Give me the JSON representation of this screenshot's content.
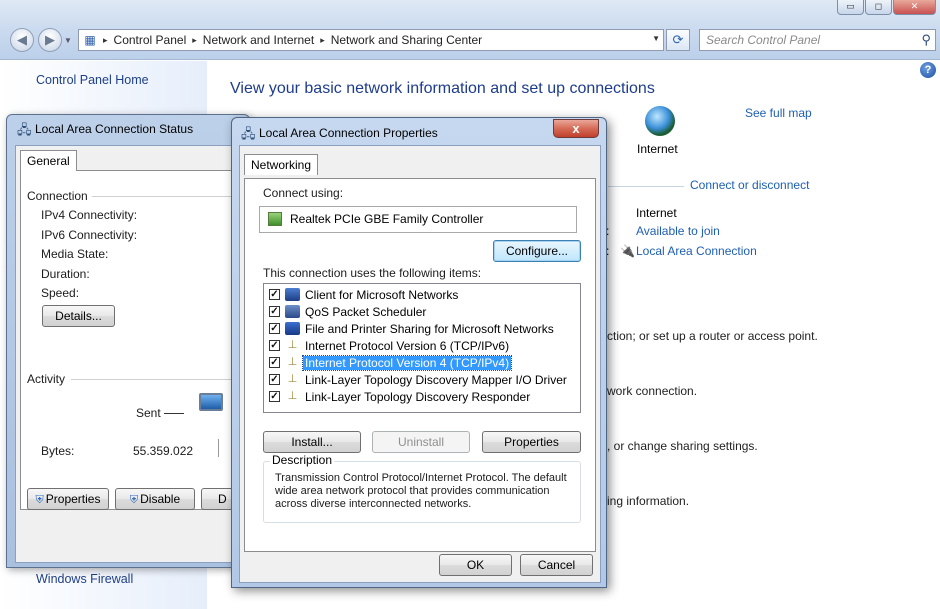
{
  "explorer": {
    "breadcrumb": [
      "Control Panel",
      "Network and Internet",
      "Network and Sharing Center"
    ],
    "search_placeholder": "Search Control Panel",
    "left_nav": {
      "home": "Control Panel Home",
      "firewall": "Windows Firewall"
    },
    "heading": "View your basic network information and set up connections",
    "see_full_map": "See full map",
    "internet_label": "Internet",
    "connect_or_disconnect": "Connect or disconnect",
    "access_type_value": "Internet",
    "homegroup_value": "Available to join",
    "connections_value": "Local Area Connection",
    "partial_lines": [
      "ction; or set up a router or access point.",
      "work connection.",
      ", or change sharing settings.",
      "ing information."
    ],
    "window_buttons": {
      "minimize": "▭",
      "maximize": "◻",
      "close": "✕"
    }
  },
  "status_dialog": {
    "title": "Local Area Connection Status",
    "tab": "General",
    "connection_group": "Connection",
    "fields": [
      "IPv4 Connectivity:",
      "IPv6 Connectivity:",
      "Media State:",
      "Duration:",
      "Speed:"
    ],
    "details_button": "Details...",
    "activity_group": "Activity",
    "sent_label": "Sent",
    "bytes_label": "Bytes:",
    "bytes_sent": "55.359.022",
    "buttons": {
      "properties": "Properties",
      "disable": "Disable",
      "diagnose_partial": "D"
    }
  },
  "properties_dialog": {
    "title": "Local Area Connection Properties",
    "close_glyph": "x",
    "tab": "Networking",
    "connect_using_label": "Connect using:",
    "adapter": "Realtek PCIe GBE Family Controller",
    "configure_button": "Configure...",
    "items_label": "This connection uses the following items:",
    "items": [
      {
        "label": "Client for Microsoft Networks",
        "icon": "client-icon",
        "checked": true,
        "selected": false
      },
      {
        "label": "QoS Packet Scheduler",
        "icon": "qos-icon",
        "checked": true,
        "selected": false
      },
      {
        "label": "File and Printer Sharing for Microsoft Networks",
        "icon": "sharing-icon",
        "checked": true,
        "selected": false
      },
      {
        "label": "Internet Protocol Version 6 (TCP/IPv6)",
        "icon": "protocol-icon",
        "checked": true,
        "selected": false
      },
      {
        "label": "Internet Protocol Version 4 (TCP/IPv4)",
        "icon": "protocol-icon",
        "checked": true,
        "selected": true
      },
      {
        "label": "Link-Layer Topology Discovery Mapper I/O Driver",
        "icon": "protocol-icon",
        "checked": true,
        "selected": false
      },
      {
        "label": "Link-Layer Topology Discovery Responder",
        "icon": "protocol-icon",
        "checked": true,
        "selected": false
      }
    ],
    "install_button": "Install...",
    "uninstall_button": "Uninstall",
    "properties_button": "Properties",
    "description_label": "Description",
    "description_text": "Transmission Control Protocol/Internet Protocol. The default wide area network protocol that provides communication across diverse interconnected networks.",
    "ok_button": "OK",
    "cancel_button": "Cancel"
  }
}
